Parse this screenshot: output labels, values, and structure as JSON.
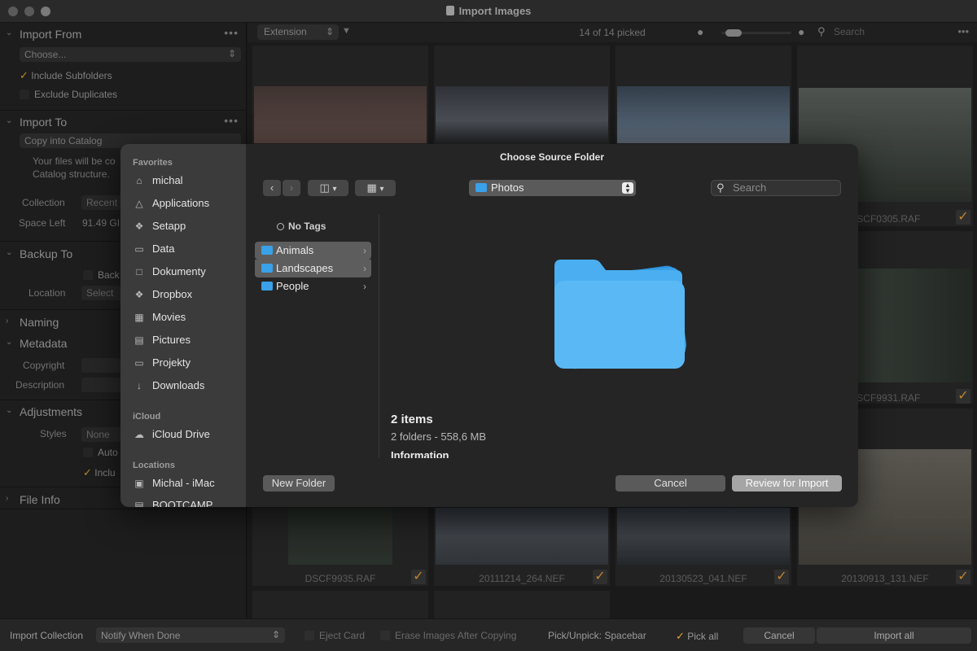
{
  "window": {
    "title": "Import Images"
  },
  "left_panel": {
    "import_from": {
      "header": "Import From",
      "source_placeholder": "Choose...",
      "include_subfolders": "Include Subfolders",
      "exclude_duplicates": "Exclude Duplicates"
    },
    "import_to": {
      "header": "Import To",
      "mode": "Copy into Catalog",
      "desc_line1": "Your files will be co",
      "desc_line2": "Catalog structure.",
      "collection_label": "Collection",
      "collection_value": "Recent",
      "space_left_label": "Space Left",
      "space_left_value": "91.49 GI"
    },
    "backup_to": {
      "header": "Backup To",
      "backup_check": "Back",
      "location_label": "Location",
      "location_placeholder": "Select"
    },
    "naming": {
      "header": "Naming"
    },
    "metadata": {
      "header": "Metadata",
      "copyright_label": "Copyright",
      "description_label": "Description"
    },
    "adjustments": {
      "header": "Adjustments",
      "styles_label": "Styles",
      "styles_value": "None",
      "auto_check": "Auto",
      "include_check": "Inclu"
    },
    "file_info": {
      "header": "File Info"
    }
  },
  "toolbar": {
    "sort": "Extension",
    "picked": "14 of 14 picked",
    "search_placeholder": "Search"
  },
  "grid": {
    "files": [
      {
        "name": "DSCF0305.RAF"
      },
      {
        "name": "DSCF9931.RAF"
      },
      {
        "name": "DSCF9935.RAF"
      },
      {
        "name": "20111214_264.NEF"
      },
      {
        "name": "20130523_041.NEF"
      },
      {
        "name": "20130913_131.NEF"
      }
    ]
  },
  "bottom_bar": {
    "import_collection_label": "Import Collection",
    "notify_value": "Notify When Done",
    "eject_card": "Eject Card",
    "erase_images": "Erase Images After Copying",
    "pick_hint": "Pick/Unpick: Spacebar",
    "pick_all": "Pick all",
    "cancel": "Cancel",
    "import_all": "Import all"
  },
  "dialog": {
    "title": "Choose Source Folder",
    "sidebar": {
      "favorites_header": "Favorites",
      "favorites": [
        {
          "label": "michal",
          "icon": "home-icon"
        },
        {
          "label": "Applications",
          "icon": "applications-icon"
        },
        {
          "label": "Setapp",
          "icon": "setapp-icon"
        },
        {
          "label": "Data",
          "icon": "folder-icon"
        },
        {
          "label": "Dokumenty",
          "icon": "document-icon"
        },
        {
          "label": "Dropbox",
          "icon": "dropbox-icon"
        },
        {
          "label": "Movies",
          "icon": "movies-icon"
        },
        {
          "label": "Pictures",
          "icon": "pictures-icon"
        },
        {
          "label": "Projekty",
          "icon": "folder-icon"
        },
        {
          "label": "Downloads",
          "icon": "downloads-icon"
        }
      ],
      "icloud_header": "iCloud",
      "icloud": [
        {
          "label": "iCloud Drive",
          "icon": "cloud-icon"
        }
      ],
      "locations_header": "Locations",
      "locations": [
        {
          "label": "Michal - iMac",
          "icon": "computer-icon"
        },
        {
          "label": "BOOTCAMP",
          "icon": "disk-icon"
        }
      ]
    },
    "path": "Photos",
    "search_placeholder": "Search",
    "tags_label": "No Tags",
    "folders": [
      {
        "label": "Animals",
        "selected": true
      },
      {
        "label": "Landscapes",
        "selected": true
      },
      {
        "label": "People",
        "selected": false
      }
    ],
    "preview": {
      "count": "2 items",
      "size": "2 folders - 558,6 MB",
      "info_header": "Information"
    },
    "buttons": {
      "new_folder": "New Folder",
      "cancel": "Cancel",
      "review": "Review for Import"
    }
  },
  "colors": {
    "accent_check": "#e8a23a",
    "folder_blue": "#3aa0e8"
  }
}
